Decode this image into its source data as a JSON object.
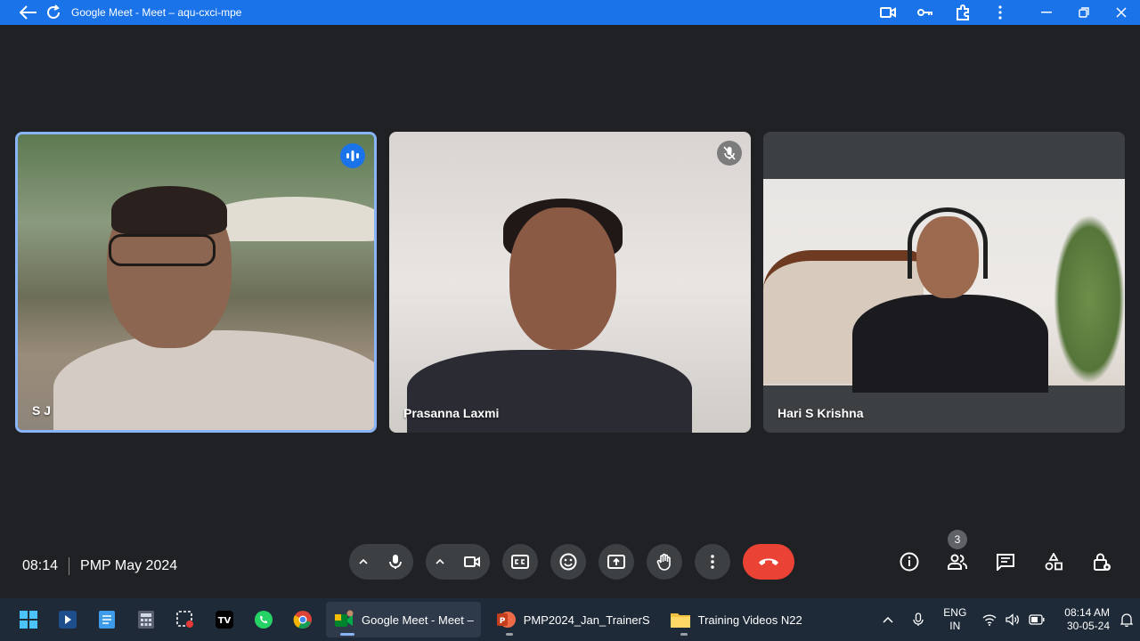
{
  "window": {
    "title": "Google Meet - Meet – aqu-cxci-mpe"
  },
  "participants": [
    {
      "name": "S J",
      "state": "speaking"
    },
    {
      "name": "Prasanna Laxmi",
      "state": "muted"
    },
    {
      "name": "Hari S Krishna",
      "state": ""
    }
  ],
  "meeting": {
    "time": "08:14",
    "name": "PMP May 2024",
    "people_count": "3"
  },
  "colors": {
    "accent": "#1a73e8",
    "end_call": "#ea4335",
    "background": "#202124",
    "button": "#3c4043"
  },
  "taskbar": {
    "apps": [
      {
        "label": "Google Meet - Meet –",
        "icon": "meet-icon"
      },
      {
        "label": "PMP2024_Jan_TrainerS",
        "icon": "powerpoint-icon"
      },
      {
        "label": "Training Videos N22",
        "icon": "folder-icon"
      }
    ],
    "lang_top": "ENG",
    "lang_bottom": "IN",
    "clock_time": "08:14 AM",
    "clock_date": "30-05-24"
  }
}
